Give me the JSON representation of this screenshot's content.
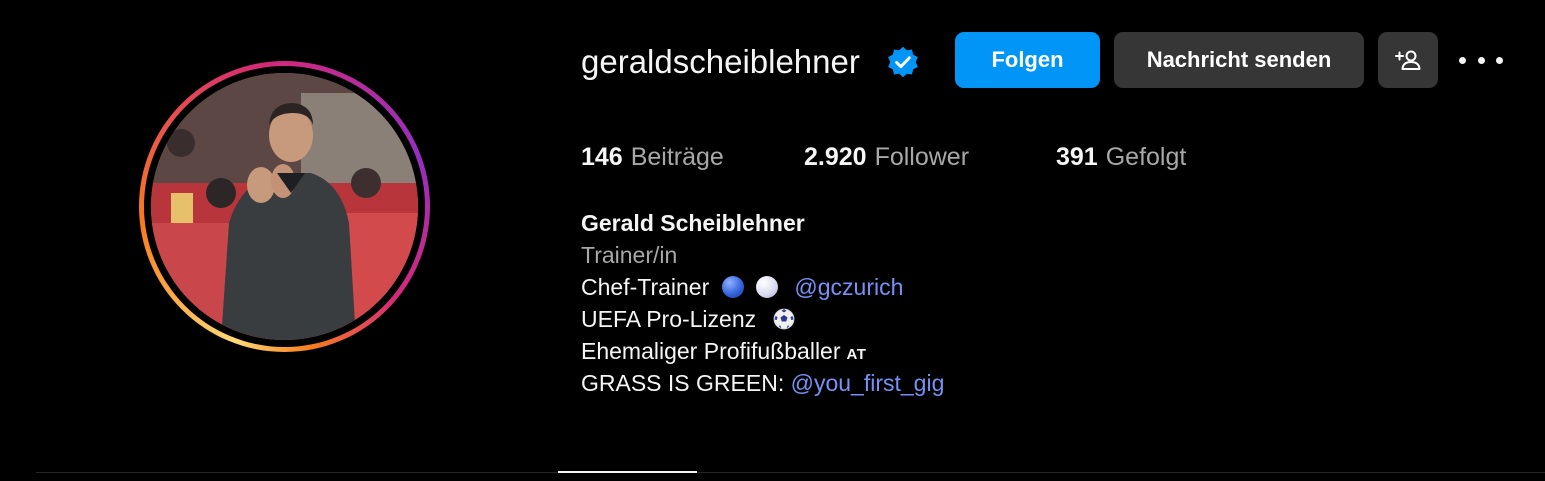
{
  "profile": {
    "username": "geraldscheiblehner",
    "verified": true,
    "full_name": "Gerald Scheiblehner",
    "category": "Trainer/in"
  },
  "actions": {
    "follow_label": "Folgen",
    "message_label": "Nachricht senden",
    "suggest_icon": "add-person-icon",
    "more_icon": "ellipsis-icon"
  },
  "stats": {
    "posts": {
      "value": "146",
      "label": "Beiträge"
    },
    "followers": {
      "value": "2.920",
      "label": "Follower"
    },
    "following": {
      "value": "391",
      "label": "Gefolgt"
    }
  },
  "bio": {
    "line1": {
      "text": "Chef-Trainer",
      "emoji": [
        "blue-circle",
        "white-circle"
      ],
      "mention": "@gczurich"
    },
    "line2": {
      "text": "UEFA Pro-Lizenz",
      "emoji": "soccer-ball"
    },
    "line3": {
      "text": "Ehemaliger Profifußballer",
      "flag": "AT"
    },
    "line4": {
      "text": "GRASS IS GREEN: ",
      "mention": "@you_first_gig"
    }
  },
  "colors": {
    "background": "#000000",
    "primary_button": "#0095f6",
    "secondary_button": "#363636",
    "secondary_text": "#a8a8a8",
    "link": "#7891f6",
    "verified_badge": "#0095f6"
  }
}
